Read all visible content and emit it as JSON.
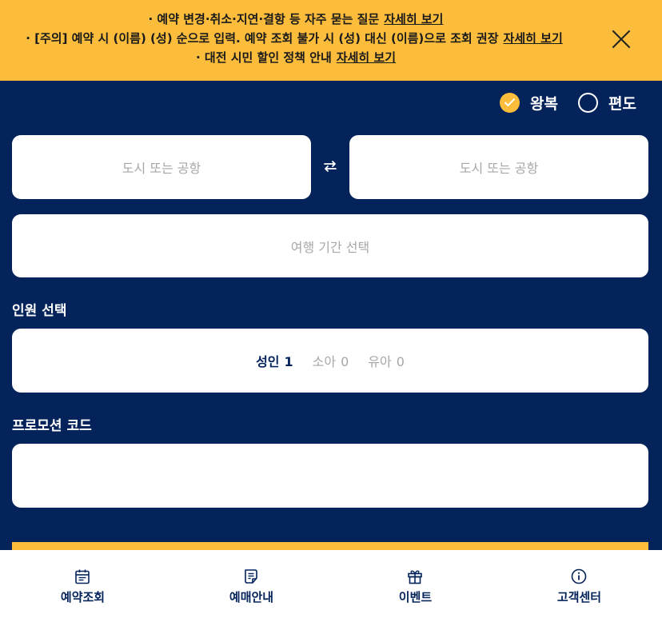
{
  "notice": {
    "lines": [
      {
        "text": "· 예약 변경·취소·지연·결항 등 자주 묻는 질문",
        "link": "자세히 보기"
      },
      {
        "text": "· [주의] 예약 시 (이름) (성) 순으로 입력. 예약 조회 불가 시 (성) 대신 (이름)으로 조회 권장",
        "link": "자세히 보기"
      },
      {
        "text": "· 대전 시민 할인 정책 안내",
        "link": "자세히 보기"
      }
    ],
    "close_icon": "close-icon"
  },
  "trip_type": {
    "round_trip": "왕복",
    "one_way": "편도",
    "selected": "왕복"
  },
  "route": {
    "from_placeholder": "도시 또는 공항",
    "to_placeholder": "도시 또는 공항",
    "swap_icon": "swap-icon"
  },
  "dates": {
    "placeholder": "여행 기간 선택"
  },
  "passengers": {
    "label": "인원 선택",
    "adult_label": "성인",
    "adult_count": "1",
    "child_label": "소아",
    "child_count": "0",
    "infant_label": "유아",
    "infant_count": "0"
  },
  "promo": {
    "label": "프로모션 코드",
    "value": ""
  },
  "tabs": [
    {
      "label": "예약조회",
      "icon": "calendar-icon"
    },
    {
      "label": "예매안내",
      "icon": "document-icon"
    },
    {
      "label": "이벤트",
      "icon": "gift-icon"
    },
    {
      "label": "고객센터",
      "icon": "info-icon"
    }
  ],
  "colors": {
    "navy": "#04235a",
    "accent": "#fcbc3c",
    "placeholder": "#a7a7a7"
  }
}
